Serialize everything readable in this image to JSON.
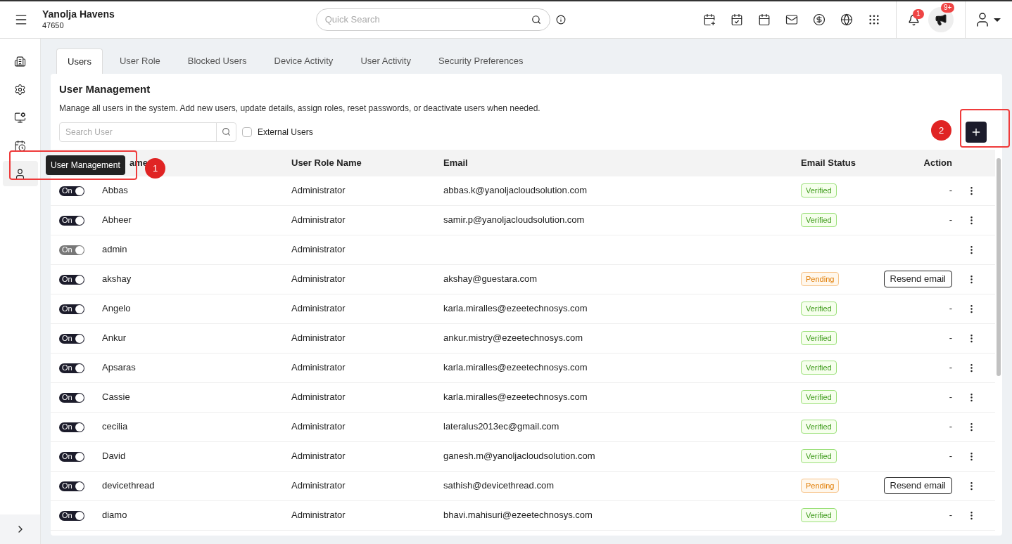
{
  "header": {
    "property_name": "Yanolja Havens",
    "property_id": "47650",
    "search": {
      "placeholder": "Quick Search"
    },
    "notifications_badge": "1",
    "announcements_badge": "9+"
  },
  "sidebar": {
    "items": [
      {
        "kind": "building",
        "selected": false
      },
      {
        "kind": "settings",
        "selected": false
      },
      {
        "kind": "monitor",
        "selected": false
      },
      {
        "kind": "calendar",
        "selected": false
      },
      {
        "kind": "user",
        "selected": true
      }
    ],
    "tooltip": "User Management"
  },
  "tabs": [
    {
      "label": "Users",
      "selected": true
    },
    {
      "label": "User Role",
      "selected": false
    },
    {
      "label": "Blocked Users",
      "selected": false
    },
    {
      "label": "Device Activity",
      "selected": false
    },
    {
      "label": "User Activity",
      "selected": false
    },
    {
      "label": "Security Preferences",
      "selected": false
    }
  ],
  "panel": {
    "title": "User Management",
    "description": "Manage all users in the system. Add new users, update details, assign roles, reset passwords, or deactivate users when needed.",
    "search": {
      "placeholder": "Search User"
    },
    "external_users": {
      "label": "External Users",
      "checked": false
    }
  },
  "table": {
    "columns": [
      "ame",
      "User Role Name",
      "Email",
      "Email Status",
      "Action"
    ],
    "rows": [
      {
        "toggle": "On",
        "disabled": false,
        "name": "Abbas",
        "role": "Administrator",
        "email": "abbas.k@yanoljacloudsolution.com",
        "status": {
          "kind": "verified",
          "label": "Verified"
        },
        "action": {
          "kind": "dash",
          "label": "-"
        }
      },
      {
        "toggle": "On",
        "disabled": false,
        "name": "Abheer",
        "role": "Administrator",
        "email": "samir.p@yanoljacloudsolution.com",
        "status": {
          "kind": "verified",
          "label": "Verified"
        },
        "action": {
          "kind": "dash",
          "label": "-"
        }
      },
      {
        "toggle": "On",
        "disabled": true,
        "name": "admin",
        "role": "Administrator"
      },
      {
        "toggle": "On",
        "disabled": false,
        "name": "akshay",
        "role": "Administrator",
        "email": "akshay@guestara.com",
        "status": {
          "kind": "pending",
          "label": "Pending"
        },
        "action": {
          "kind": "button",
          "label": "Resend email"
        }
      },
      {
        "toggle": "On",
        "disabled": false,
        "name": "Angelo",
        "role": "Administrator",
        "email": "karla.miralles@ezeetechnosys.com",
        "status": {
          "kind": "verified",
          "label": "Verified"
        },
        "action": {
          "kind": "dash",
          "label": "-"
        }
      },
      {
        "toggle": "On",
        "disabled": false,
        "name": "Ankur",
        "role": "Administrator",
        "email": "ankur.mistry@ezeetechnosys.com",
        "status": {
          "kind": "verified",
          "label": "Verified"
        },
        "action": {
          "kind": "dash",
          "label": "-"
        }
      },
      {
        "toggle": "On",
        "disabled": false,
        "name": "Apsaras",
        "role": "Administrator",
        "email": "karla.miralles@ezeetechnosys.com",
        "status": {
          "kind": "verified",
          "label": "Verified"
        },
        "action": {
          "kind": "dash",
          "label": "-"
        }
      },
      {
        "toggle": "On",
        "disabled": false,
        "name": "Cassie",
        "role": "Administrator",
        "email": "karla.miralles@ezeetechnosys.com",
        "status": {
          "kind": "verified",
          "label": "Verified"
        },
        "action": {
          "kind": "dash",
          "label": "-"
        }
      },
      {
        "toggle": "On",
        "disabled": false,
        "name": "cecilia",
        "role": "Administrator",
        "email": "lateralus2013ec@gmail.com",
        "status": {
          "kind": "verified",
          "label": "Verified"
        },
        "action": {
          "kind": "dash",
          "label": "-"
        }
      },
      {
        "toggle": "On",
        "disabled": false,
        "name": "David",
        "role": "Administrator",
        "email": "ganesh.m@yanoljacloudsolution.com",
        "status": {
          "kind": "verified",
          "label": "Verified"
        },
        "action": {
          "kind": "dash",
          "label": "-"
        }
      },
      {
        "toggle": "On",
        "disabled": false,
        "name": "devicethread",
        "role": "Administrator",
        "email": "sathish@devicethread.com",
        "status": {
          "kind": "pending",
          "label": "Pending"
        },
        "action": {
          "kind": "button",
          "label": "Resend email"
        }
      },
      {
        "toggle": "On",
        "disabled": false,
        "name": "diamo",
        "role": "Administrator",
        "email": "bhavi.mahisuri@ezeetechnosys.com",
        "status": {
          "kind": "verified",
          "label": "Verified"
        },
        "action": {
          "kind": "dash",
          "label": "-"
        }
      }
    ]
  },
  "callouts": [
    "1",
    "2"
  ]
}
